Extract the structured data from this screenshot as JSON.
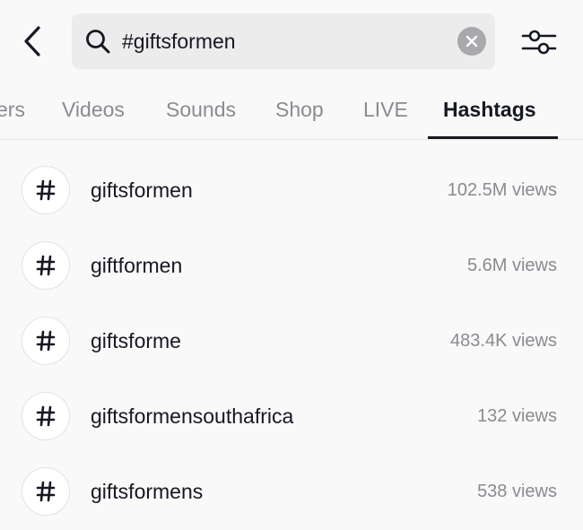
{
  "search": {
    "value": "#giftsformen"
  },
  "tabs": [
    {
      "label": "ers",
      "active": false
    },
    {
      "label": "Videos",
      "active": false
    },
    {
      "label": "Sounds",
      "active": false
    },
    {
      "label": "Shop",
      "active": false
    },
    {
      "label": "LIVE",
      "active": false
    },
    {
      "label": "Hashtags",
      "active": true
    }
  ],
  "hashtags": [
    {
      "name": "giftsformen",
      "views": "102.5M views"
    },
    {
      "name": "giftformen",
      "views": "5.6M views"
    },
    {
      "name": "giftsforme",
      "views": "483.4K views"
    },
    {
      "name": "giftsformensouthafrica",
      "views": "132 views"
    },
    {
      "name": "giftsformens",
      "views": "538 views"
    }
  ],
  "icons": {
    "back": "chevron-left-icon",
    "search": "search-icon",
    "clear": "close-icon",
    "filter": "sliders-icon",
    "hashtag": "hashtag-icon"
  },
  "colors": {
    "text_primary": "#161823",
    "text_secondary": "#8a8b91",
    "search_bg": "#ececec",
    "clear_bg": "#a9a9ad"
  }
}
